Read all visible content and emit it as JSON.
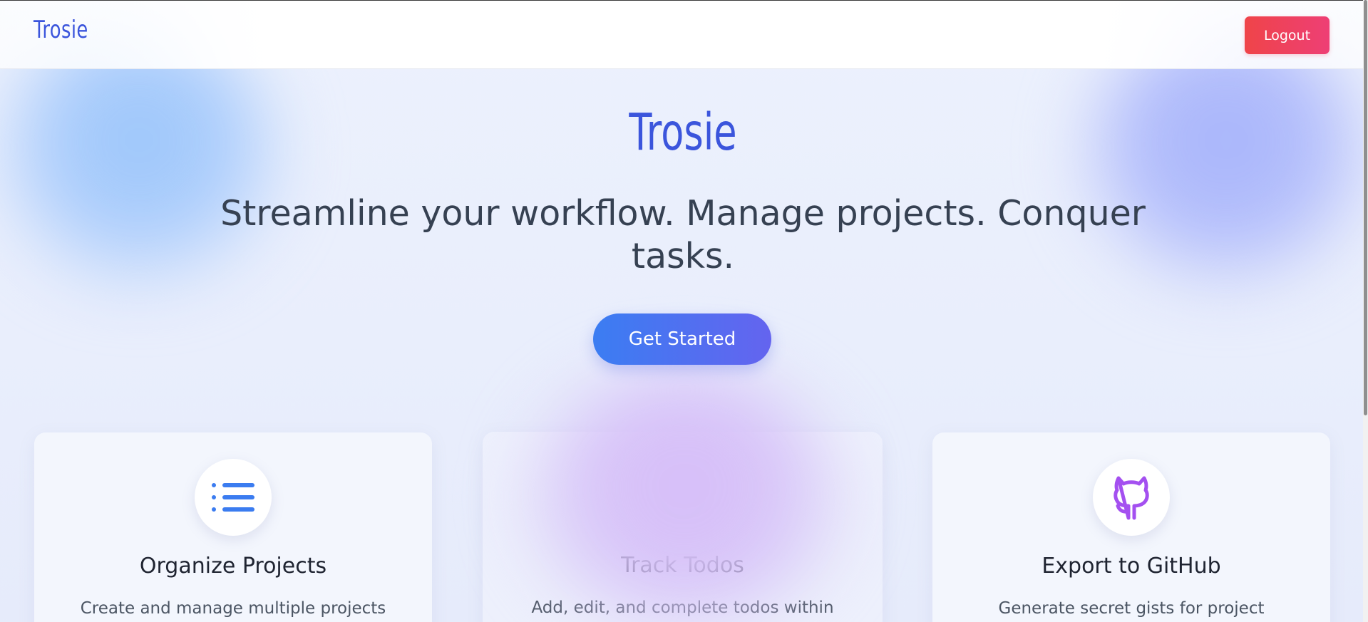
{
  "navbar": {
    "brand": "Trosie",
    "logout_label": "Logout"
  },
  "hero": {
    "logo": "Trosie",
    "tagline": "Streamline your workflow. Manage projects. Conquer tasks.",
    "cta_label": "Get Started"
  },
  "features": [
    {
      "icon": "list-icon",
      "title": "Organize Projects",
      "description": "Create and manage multiple projects"
    },
    {
      "icon": "check-circle-icon",
      "title": "Track Todos",
      "description": "Add, edit, and complete todos within"
    },
    {
      "icon": "github-icon",
      "title": "Export to GitHub",
      "description": "Generate secret gists for project"
    }
  ],
  "colors": {
    "brand_blue": "#3b55dc",
    "logout_red": "#ef4449",
    "cta_start": "#3b7df2",
    "cta_end": "#6464ef",
    "list_icon_blue": "#3b7cf0",
    "check_icon_green": "#169a55",
    "github_icon_purple": "#a450f0"
  }
}
